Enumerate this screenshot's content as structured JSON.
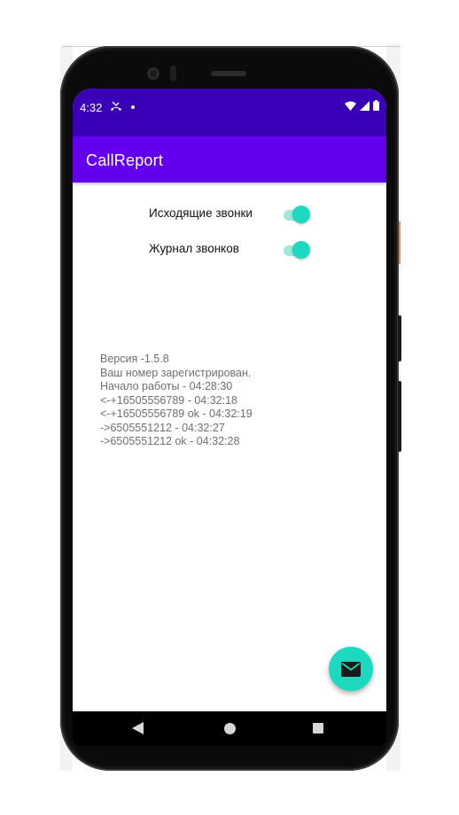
{
  "status_bar": {
    "time": "4:32",
    "icons": [
      "missed-call-icon",
      "notification-dot-icon",
      "wifi-icon",
      "signal-icon",
      "battery-icon"
    ],
    "background": "#3a00b8"
  },
  "app_bar": {
    "title": "CallReport",
    "background": "#6200ee"
  },
  "toggles": [
    {
      "label": "Исходящие звонки",
      "enabled": true
    },
    {
      "label": "Журнал звонков",
      "enabled": true
    }
  ],
  "log": {
    "lines": [
      "Версия -1.5.8",
      "Ваш номер зарегистрирован.",
      "Начало работы - 04:28:30",
      "<-+16505556789 - 04:32:18",
      "<-+16505556789 ok - 04:32:19",
      "->6505551212 - 04:32:27",
      "->6505551212 ok - 04:32:28"
    ]
  },
  "fab": {
    "icon": "mail-icon",
    "color": "#1dd9c0"
  },
  "nav_bar": {
    "icons": [
      "back-icon",
      "home-icon",
      "recents-icon"
    ]
  },
  "colors": {
    "accent": "#1dd9c0",
    "accent_track": "#9ee9dc",
    "primary": "#6200ee",
    "primary_dark": "#3a00b8"
  }
}
